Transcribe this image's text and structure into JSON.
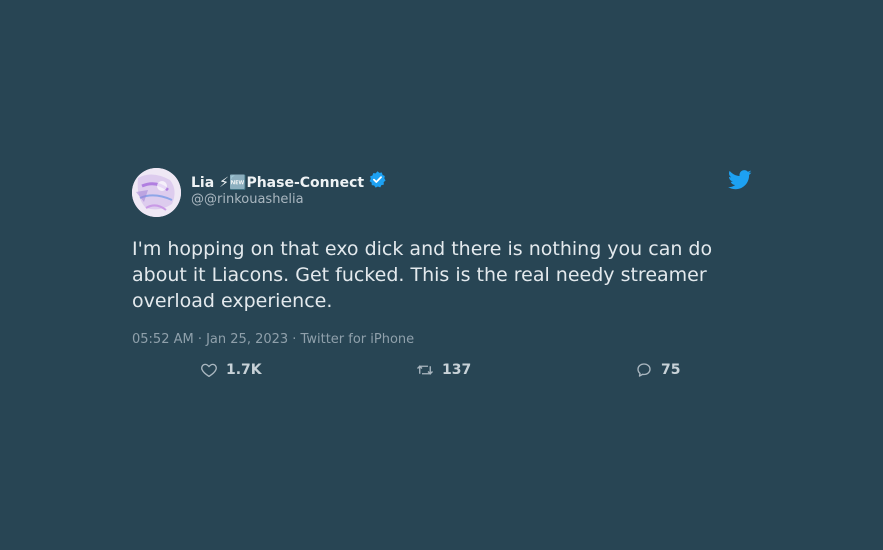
{
  "author": {
    "name": "Lia",
    "glyphs": "⚡🆕",
    "org": "Phase-Connect",
    "handle": "@@rinkouashelia",
    "verified": true
  },
  "tweet": {
    "text": "I'm hopping on that exo dick and there is nothing you can do about it Liacons. Get fucked. This is the real needy streamer overload experience.",
    "meta": "05:52 AM · Jan 25, 2023 · Twitter for iPhone"
  },
  "stats": {
    "likes": "1.7K",
    "retweets": "137",
    "replies": "75"
  },
  "icons": {
    "brand": "twitter-bird-icon",
    "like": "heart-icon",
    "retweet": "retweet-icon",
    "reply": "reply-bubble-icon",
    "verified": "verified-badge-icon"
  },
  "colors": {
    "background": "#284554",
    "twitter_blue": "#1da1f2"
  }
}
